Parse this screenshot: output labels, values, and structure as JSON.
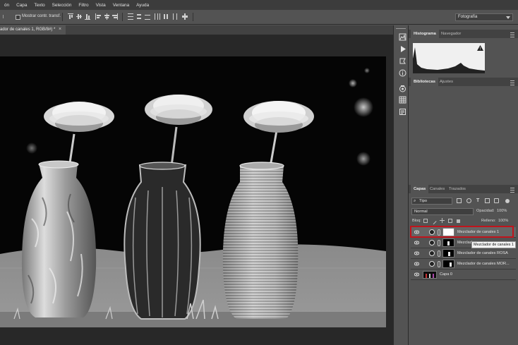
{
  "menu": {
    "items": [
      "ón",
      "Capa",
      "Texto",
      "Selección",
      "Filtro",
      "Vista",
      "Ventana",
      "Ayuda"
    ]
  },
  "options": {
    "show_transform_label": "Mostrar contr. transf."
  },
  "workspace": {
    "value": "Fotografía"
  },
  "document": {
    "tab_title": "ador de canales 1, RGB/8#) *",
    "close": "×"
  },
  "panels": {
    "top_tabs": [
      "Histograma",
      "Navegador"
    ],
    "mid_tabs": [
      "Bibliotecas",
      "Ajustes"
    ],
    "layers_tabs": [
      "Capas",
      "Canales",
      "Trazados"
    ],
    "histogram_warning": "!",
    "filter": {
      "label": "Tipo"
    },
    "blend": {
      "mode": "Normal",
      "opacity_label": "Opacidad:",
      "opacity": "100%"
    },
    "lock": {
      "label": "Bloq:",
      "fill_label": "Relleno:",
      "fill": "100%"
    },
    "layers": [
      {
        "name": "Mezclador de canales 1",
        "type": "adjust",
        "selected": true
      },
      {
        "name": "Mezclad",
        "type": "adjust",
        "selected": false
      },
      {
        "name": "Mezclador de canales ROSA",
        "type": "adjust",
        "selected": false
      },
      {
        "name": "Mezclador de canales MOR...",
        "type": "adjust",
        "selected": false
      },
      {
        "name": "Capa 0",
        "type": "pixel",
        "selected": false
      }
    ],
    "tooltip": "Mezclador de canales 1"
  },
  "colors": {
    "selection_outline": "#c0141c",
    "panel_bg": "#535353",
    "menu_bg": "#3c3c3c"
  }
}
